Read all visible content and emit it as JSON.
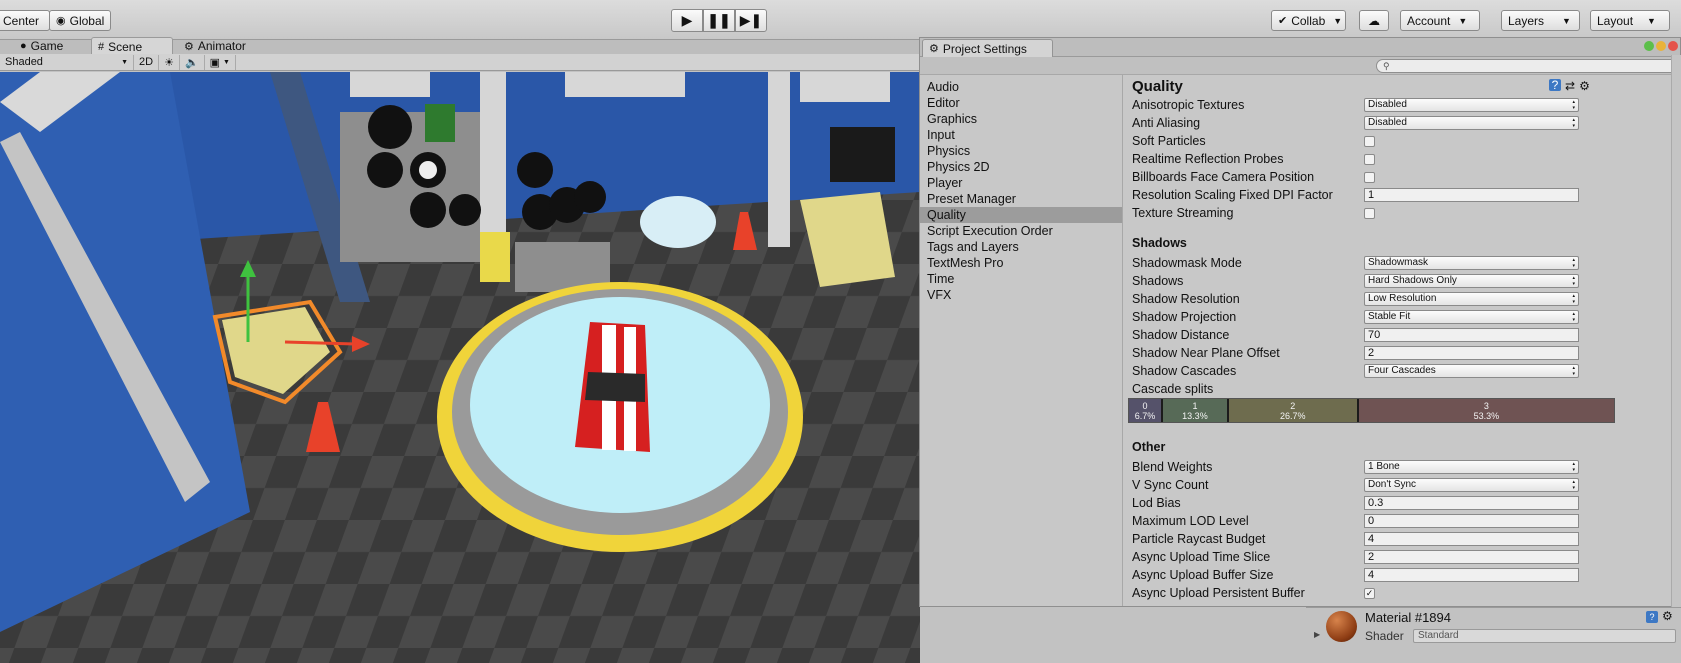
{
  "toolbar": {
    "pivot_label": "Center",
    "global_label": "Global",
    "collab_label": "Collab",
    "account_label": "Account",
    "layers_label": "Layers",
    "layout_label": "Layout"
  },
  "editor_tabs": [
    {
      "label": "Game"
    },
    {
      "label": "Scene"
    },
    {
      "label": "Animator"
    }
  ],
  "scene_toolbar": {
    "shading_mode": "Shaded",
    "mode_2d": "2D"
  },
  "project_settings": {
    "title": "Project Settings",
    "search_placeholder": "",
    "nav_items": [
      "Audio",
      "Editor",
      "Graphics",
      "Input",
      "Physics",
      "Physics 2D",
      "Player",
      "Preset Manager",
      "Quality",
      "Script Execution Order",
      "Tags and Layers",
      "TextMesh Pro",
      "Time",
      "VFX"
    ],
    "selected_nav": "Quality",
    "heading": "Quality",
    "rendering_rows": [
      {
        "label": "Anisotropic Textures",
        "type": "dropdown",
        "value": "Disabled"
      },
      {
        "label": "Anti Aliasing",
        "type": "dropdown",
        "value": "Disabled"
      },
      {
        "label": "Soft Particles",
        "type": "checkbox",
        "value": "false"
      },
      {
        "label": "Realtime Reflection Probes",
        "type": "checkbox",
        "value": "false"
      },
      {
        "label": "Billboards Face Camera Position",
        "type": "checkbox",
        "value": "false"
      },
      {
        "label": "Resolution Scaling Fixed DPI Factor",
        "type": "text",
        "value": "1"
      },
      {
        "label": "Texture Streaming",
        "type": "checkbox",
        "value": "false"
      }
    ],
    "shadows_section": "Shadows",
    "shadow_rows": [
      {
        "label": "Shadowmask Mode",
        "type": "dropdown",
        "value": "Shadowmask"
      },
      {
        "label": "Shadows",
        "type": "dropdown",
        "value": "Hard Shadows Only"
      },
      {
        "label": "Shadow Resolution",
        "type": "dropdown",
        "value": "Low Resolution"
      },
      {
        "label": "Shadow Projection",
        "type": "dropdown",
        "value": "Stable Fit"
      },
      {
        "label": "Shadow Distance",
        "type": "text",
        "value": "70"
      },
      {
        "label": "Shadow Near Plane Offset",
        "type": "text",
        "value": "2"
      },
      {
        "label": "Shadow Cascades",
        "type": "dropdown",
        "value": "Four Cascades"
      }
    ],
    "cascade_label": "Cascade splits",
    "cascades": [
      {
        "index": "0",
        "percent": "6.7%",
        "fraction": 0.067,
        "color": "#55526a"
      },
      {
        "index": "1",
        "percent": "13.3%",
        "fraction": 0.133,
        "color": "#576a57"
      },
      {
        "index": "2",
        "percent": "26.7%",
        "fraction": 0.267,
        "color": "#6e6c4e"
      },
      {
        "index": "3",
        "percent": "53.3%",
        "fraction": 0.533,
        "color": "#6f5353"
      }
    ],
    "other_section": "Other",
    "other_rows": [
      {
        "label": "Blend Weights",
        "type": "dropdown",
        "value": "1 Bone"
      },
      {
        "label": "V Sync Count",
        "type": "dropdown",
        "value": "Don't Sync"
      },
      {
        "label": "Lod Bias",
        "type": "text",
        "value": "0.3"
      },
      {
        "label": "Maximum LOD Level",
        "type": "text",
        "value": "0"
      },
      {
        "label": "Particle Raycast Budget",
        "type": "text",
        "value": "4"
      },
      {
        "label": "Async Upload Time Slice",
        "type": "text",
        "value": "2"
      },
      {
        "label": "Async Upload Buffer Size",
        "type": "text",
        "value": "4"
      },
      {
        "label": "Async Upload Persistent Buffer",
        "type": "checkbox",
        "value": "true"
      }
    ]
  },
  "inspector": {
    "material_name": "Material #1894",
    "shader_label": "Shader",
    "shader_value": "Standard"
  },
  "colors": {
    "scene_wall": "#2a57a8",
    "platform": "#bfeef8",
    "car": "#d62020",
    "selection_outline": "#f28a2a"
  }
}
